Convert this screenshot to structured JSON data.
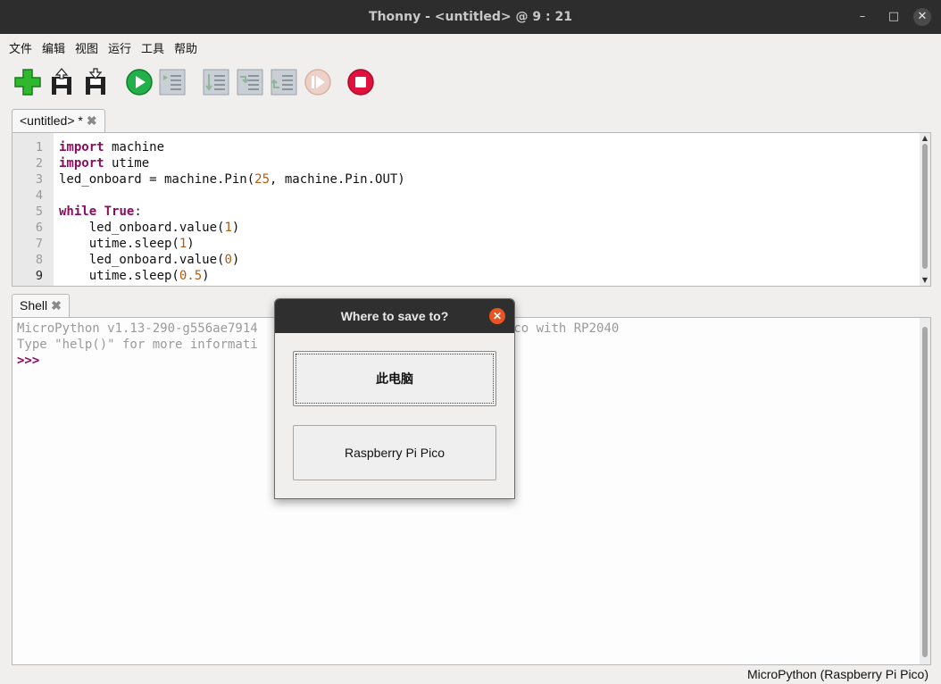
{
  "window": {
    "title": "Thonny  -  <untitled>  @  9 : 21",
    "minimize_glyph": "–",
    "maximize_glyph": "□",
    "close_glyph": "✕"
  },
  "menu": [
    "文件",
    "编辑",
    "视图",
    "运行",
    "工具",
    "帮助"
  ],
  "toolbar": {
    "icons": [
      "new-file-icon",
      "open-file-icon",
      "save-file-icon",
      "run-icon",
      "debug-icon",
      "step-over-icon",
      "step-into-icon",
      "step-out-icon",
      "resume-icon",
      "stop-icon"
    ]
  },
  "editor": {
    "tab_label": "<untitled> *",
    "tab_close": "✖",
    "line_numbers": [
      "1",
      "2",
      "3",
      "4",
      "5",
      "6",
      "7",
      "8",
      "9"
    ],
    "lines": [
      [
        {
          "t": "import",
          "k": "kw"
        },
        {
          "t": " machine"
        }
      ],
      [
        {
          "t": "import",
          "k": "kw"
        },
        {
          "t": " utime"
        }
      ],
      [
        {
          "t": "led_onboard = machine.Pin("
        },
        {
          "t": "25",
          "k": "num"
        },
        {
          "t": ", machine.Pin.OUT)"
        }
      ],
      [
        {
          "t": ""
        }
      ],
      [
        {
          "t": "while",
          "k": "kw"
        },
        {
          "t": " "
        },
        {
          "t": "True",
          "k": "kw"
        },
        {
          "t": ":"
        }
      ],
      [
        {
          "t": "    led_onboard.value("
        },
        {
          "t": "1",
          "k": "num"
        },
        {
          "t": ")"
        }
      ],
      [
        {
          "t": "    utime.sleep("
        },
        {
          "t": "1",
          "k": "num"
        },
        {
          "t": ")"
        }
      ],
      [
        {
          "t": "    led_onboard.value("
        },
        {
          "t": "0",
          "k": "num"
        },
        {
          "t": ")"
        }
      ],
      [
        {
          "t": "    utime.sleep("
        },
        {
          "t": "0.5",
          "k": "num"
        },
        {
          "t": ")"
        }
      ]
    ]
  },
  "shell": {
    "tab_label": "Shell",
    "tab_close": "✖",
    "banner_line1": "MicroPython v1.13-290-g556ae7914                                 ico with RP2040",
    "banner_line2": "Type \"help()\" for more informati",
    "prompt": ">>>"
  },
  "status": {
    "interpreter": "MicroPython (Raspberry Pi Pico)"
  },
  "dialog": {
    "title": "Where to save to?",
    "close_glyph": "✕",
    "option_computer": "此电脑",
    "option_pico": "Raspberry Pi Pico"
  }
}
